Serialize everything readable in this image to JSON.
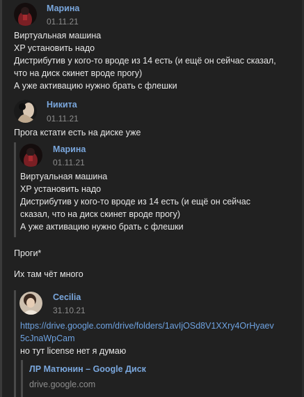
{
  "messages": {
    "marina": {
      "author": "Марина",
      "date": "01.11.21",
      "lines": [
        "Виртуальная машина",
        "XP установить надо",
        "Дистрибутив у кого-то вроде из 14 есть (и ещё он сейчас сказал,",
        "что на диск скинет вроде прогу)",
        "А уже активацию нужно брать с флешки"
      ]
    },
    "nikita": {
      "author": "Никита",
      "date": "01.11.21",
      "text": "Прога кстати есть на диске уже",
      "quote": {
        "author": "Марина",
        "date": "01.11.21",
        "lines": [
          "Виртуальная машина",
          "XP установить надо",
          "Дистрибутив у кого-то вроде из 14 есть (и ещё он сейчас",
          "сказал, что на диск скинет вроде прогу)",
          "А уже активацию нужно брать с флешки"
        ]
      },
      "extra": [
        "Проги*",
        "Их там чёт много"
      ],
      "quote2": {
        "author": "Cecilia",
        "date": "31.10.21",
        "link_lines": [
          "https://drive.google.com/drive/folders/1avIjOSd8V1XXry4OrHyaev",
          "5cJnaWpCam"
        ],
        "text": "но тут license нет я думаю",
        "preview": {
          "title": "ЛР Матюнин – Google Диск",
          "domain": "drive.google.com"
        }
      }
    }
  },
  "colors": {
    "background": "#212121",
    "name": "#7aa7dd",
    "link": "#6ea2e0",
    "date": "#8d8d8d"
  }
}
